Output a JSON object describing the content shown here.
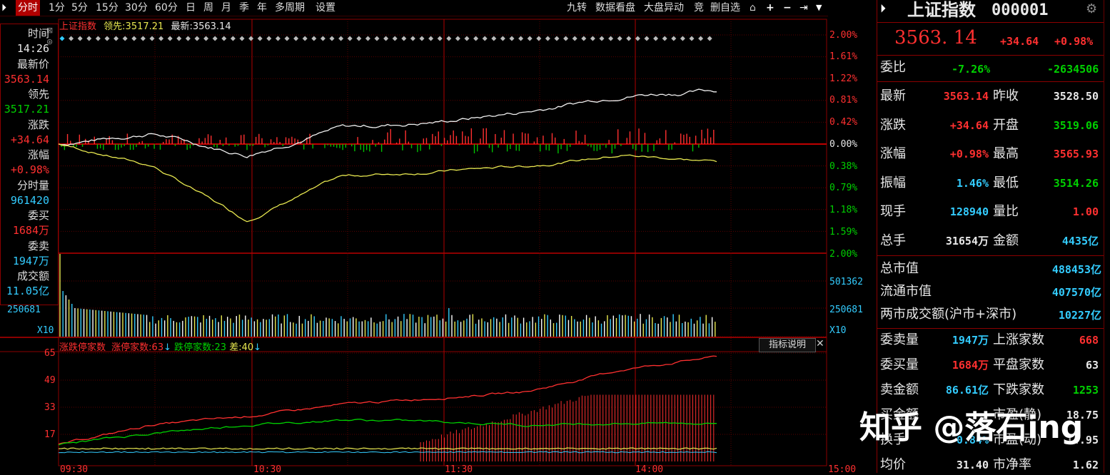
{
  "toolbar": {
    "left_items": [
      "分时",
      "1分",
      "5分",
      "15分",
      "30分",
      "60分",
      "日",
      "周",
      "月",
      "季",
      "年",
      "多周期",
      "设置"
    ],
    "right_items": [
      "九转",
      "数据看盘",
      "大盘异动",
      "竞",
      "删自选"
    ],
    "icons": [
      "pin-icon",
      "plus-icon",
      "minus-icon",
      "collapse-icon",
      "dropdown-icon"
    ]
  },
  "chart_header": {
    "index_name": "上证指数",
    "lead_label": "领先:",
    "lead_value": "3517.21",
    "latest_label": "最新:",
    "latest_value": "3563.14"
  },
  "left_panel": {
    "rows": [
      {
        "label": "时间",
        "value": "14:26",
        "color": "#e8e8e8"
      },
      {
        "label": "最新价",
        "value": "3563.14",
        "color": "#ff3030"
      },
      {
        "label": "领先",
        "value": "3517.21",
        "color": "#00d000"
      },
      {
        "label": "涨跌",
        "value": "+34.64",
        "color": "#ff3030"
      },
      {
        "label": "涨幅",
        "value": "+0.98%",
        "color": "#ff3030"
      },
      {
        "label": "分时量",
        "value": "961420",
        "color": "#33ccff"
      },
      {
        "label": "委买",
        "value": "1684万",
        "color": "#ff3030"
      },
      {
        "label": "委卖",
        "value": "1947万",
        "color": "#33ccff"
      },
      {
        "label": "成交额",
        "value": "11.05亿",
        "color": "#33ccff"
      }
    ]
  },
  "price_axis": {
    "right_labels": [
      "2.00%",
      "1.61%",
      "1.22%",
      "0.81%",
      "0.42%",
      "0.00%",
      "0.38%",
      "0.79%",
      "1.18%",
      "1.59%",
      "2.00%"
    ]
  },
  "volume_axis": {
    "right_labels": [
      "501362",
      "250681"
    ],
    "left_label": "250681",
    "x10": "X10"
  },
  "indicator_panel": {
    "title": "涨跌停家数",
    "up_label": "涨停家数:",
    "up_value": "63",
    "down_label": "跌停家数:",
    "down_value": "23",
    "diff_label": "差:",
    "diff_value": "40",
    "help_button": "指标说明",
    "y_labels": [
      "65",
      "49",
      "33",
      "17"
    ]
  },
  "time_axis": [
    "09:30",
    "10:30",
    "11:30",
    "14:00",
    "15:00"
  ],
  "right_panel": {
    "title": "上证指数",
    "code": "000001",
    "price": "3563. 14",
    "change": "+34.64",
    "change_pct": "+0.98%",
    "weibi_label": "委比",
    "weibi_pct": "-7.26%",
    "weibi_val": "-2634506",
    "quote_rows": [
      {
        "l1": "最新",
        "v1": "3563.14",
        "c1": "#ff3030",
        "l2": "昨收",
        "v2": "3528.50",
        "c2": "#e8e8e8"
      },
      {
        "l1": "涨跌",
        "v1": "+34.64",
        "c1": "#ff3030",
        "l2": "开盘",
        "v2": "3519.06",
        "c2": "#00d000"
      },
      {
        "l1": "涨幅",
        "v1": "+0.98%",
        "c1": "#ff3030",
        "l2": "最高",
        "v2": "3565.93",
        "c2": "#ff3030"
      },
      {
        "l1": "振幅",
        "v1": "1.46%",
        "c1": "#33ccff",
        "l2": "最低",
        "v2": "3514.26",
        "c2": "#00d000"
      },
      {
        "l1": "现手",
        "v1": "128940",
        "c1": "#33ccff",
        "l2": "量比",
        "v2": "1.00",
        "c2": "#ff3030"
      },
      {
        "l1": "总手",
        "v1": "31654万",
        "c1": "#e8e8e8",
        "l2": "金额",
        "v2": "4435亿",
        "c2": "#33ccff"
      }
    ],
    "market_rows": [
      {
        "label": "总市值",
        "value": "488453亿"
      },
      {
        "label": "流通市值",
        "value": "407570亿"
      },
      {
        "label": "两市成交额(沪市+深市)",
        "value": "10227亿"
      }
    ],
    "bottom_rows": [
      {
        "l1": "委卖量",
        "v1": "1947万",
        "c1": "#33ccff",
        "l2": "上涨家数",
        "v2": "668",
        "c2": "#ff3030"
      },
      {
        "l1": "委买量",
        "v1": "1684万",
        "c1": "#ff3030",
        "l2": "平盘家数",
        "v2": "63",
        "c2": "#e8e8e8"
      },
      {
        "l1": "卖金额",
        "v1": "86.61亿",
        "c1": "#33ccff",
        "l2": "下跌家数",
        "v2": "1253",
        "c2": "#00d000"
      },
      {
        "l1": "买金额",
        "v1": "",
        "c1": "#33ccff",
        "l2": "市盈(静)",
        "v2": "18.75",
        "c2": "#e8e8e8"
      },
      {
        "l1": "换手",
        "v1": "0.84%",
        "c1": "#33ccff",
        "l2": "市盈(动)",
        "v2": "14.95",
        "c2": "#e8e8e8"
      },
      {
        "l1": "均价",
        "v1": "31.40",
        "c1": "#e8e8e8",
        "l2": "市净率",
        "v2": "1.62",
        "c2": "#e8e8e8"
      }
    ]
  },
  "watermark": "知乎 @落石ing",
  "chart_data": {
    "type": "line",
    "x": [
      "09:30",
      "10:00",
      "10:30",
      "11:00",
      "11:30",
      "13:30",
      "14:00",
      "14:26"
    ],
    "series": [
      {
        "name": "上证指数",
        "values": [
          0.0,
          0.2,
          -0.2,
          0.3,
          0.4,
          0.6,
          0.9,
          0.98
        ]
      },
      {
        "name": "领先",
        "values": [
          0.0,
          -0.4,
          -1.4,
          -0.6,
          -0.5,
          -0.4,
          -0.2,
          -0.32
        ]
      }
    ],
    "ylim": [
      -2.0,
      2.0
    ],
    "indicator": {
      "series": [
        {
          "name": "涨停家数",
          "values": [
            10,
            22,
            27,
            34,
            38,
            42,
            55,
            63
          ]
        },
        {
          "name": "跌停家数",
          "values": [
            10,
            17,
            22,
            25,
            24,
            22,
            23,
            23
          ]
        }
      ],
      "ylim": [
        0,
        65
      ]
    }
  },
  "colors": {
    "accent_red": "#ff3030",
    "down_green": "#00d000",
    "value_cyan": "#33ccff",
    "grid_red": "#8b0000"
  }
}
